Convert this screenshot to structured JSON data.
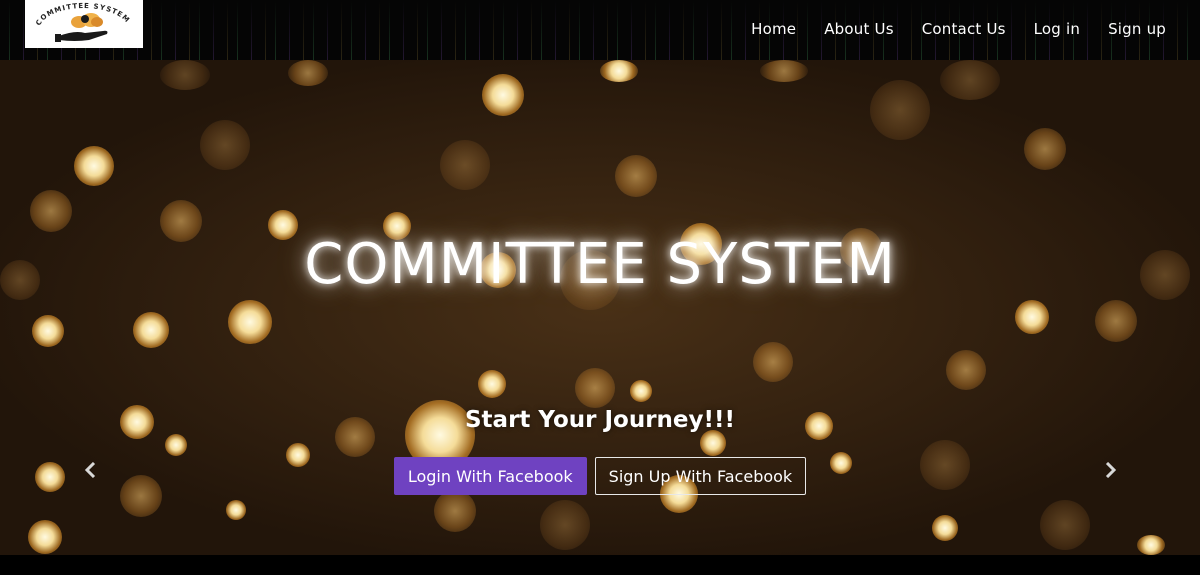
{
  "navbar": {
    "logo": {
      "alt": "Committee System logo",
      "text": "COMMITTEE SYSTEM"
    },
    "links": [
      {
        "label": "Home",
        "icon": null
      },
      {
        "label": "About Us",
        "icon": null
      },
      {
        "label": "Contact Us",
        "icon": null
      },
      {
        "label": "Log in",
        "icon": null
      },
      {
        "label": "Sign up",
        "icon": null
      }
    ]
  },
  "hero": {
    "title": "COMMITTEE SYSTEM",
    "subtitle": "Start Your Journey!!!",
    "buttons": {
      "login_facebook": "Login With Facebook",
      "signup_facebook": "Sign Up With Facebook"
    },
    "carousel": {
      "prev_icon": "chevron-left-icon",
      "next_icon": "chevron-right-icon"
    }
  },
  "colors": {
    "primary_button": "#6f42c1",
    "navbar_bg": "#050505",
    "hero_wood": "#34200f",
    "text": "#ffffff"
  }
}
